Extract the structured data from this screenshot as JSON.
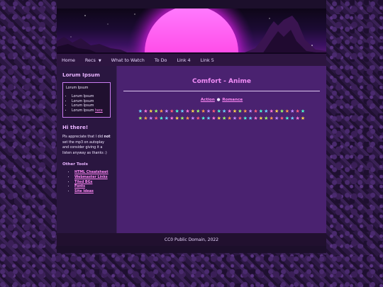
{
  "nav": {
    "items": [
      {
        "label": "Home"
      },
      {
        "label": "Recs",
        "caret": "▼"
      },
      {
        "label": "What to Watch"
      },
      {
        "label": "To Do"
      },
      {
        "label": "Link 4"
      },
      {
        "label": "Link 5"
      }
    ]
  },
  "sidebar": {
    "title": "Lorum Ipsum",
    "box": {
      "title": "Lorum Ipsum",
      "items": [
        "Lorum Ipsum",
        "Lorum Ipsum",
        "Lorum Ipsum"
      ],
      "last_item_text": "Lorum Ipsum",
      "last_item_link": "here"
    },
    "hi_title": "Hi there!",
    "hi_text_before": "Pls appreciate that I did ",
    "hi_text_bold": "not",
    "hi_text_after": " set the mp3 on autoplay and consider giving it a listen anyway as thanks :)",
    "tools_title": "Other Tools",
    "tools": [
      "HTML Cheatsheet",
      "Webmaster Links",
      "Tiled BGs",
      "Fonts",
      "Site Ideas"
    ]
  },
  "content": {
    "title": "Comfort - Anime",
    "tag1": "Action",
    "tag_sep": "●",
    "tag2": "Romance",
    "stars": [
      "★",
      "★",
      "★",
      "★",
      "★",
      "★",
      "★",
      "★",
      "★",
      "★",
      "★",
      "★",
      "★",
      "★",
      "★",
      "★",
      "★",
      "★",
      "★",
      "★",
      "★",
      "★",
      "★",
      "★",
      "★",
      "★",
      "★",
      "★",
      "★",
      "★",
      "★",
      "★"
    ],
    "star_colors": [
      "#6fd3ff",
      "#ff7ad9",
      "#ffd84d",
      "#9cff6b",
      "#ff9a4d",
      "#c38bff",
      "#ff5f7a",
      "#4dffd2"
    ]
  },
  "footer": {
    "text": "CC0 Public Domain, 2022"
  }
}
